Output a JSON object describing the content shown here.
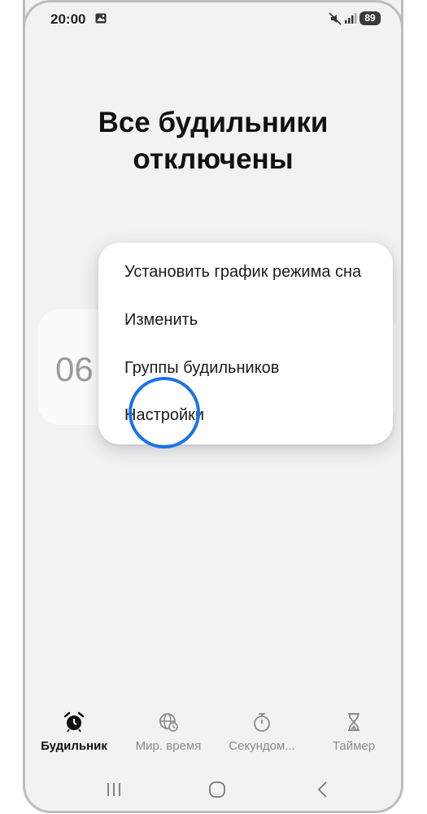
{
  "status_bar": {
    "time": "20:00",
    "battery": "89",
    "icons": [
      "gallery-icon",
      "mute-icon",
      "signal-icon",
      "battery-icon"
    ]
  },
  "main": {
    "headline_line1": "Все будильники",
    "headline_line2": "отключены",
    "alarm_time_partial": "06"
  },
  "menu": {
    "items": [
      {
        "label": "Установить график режима сна"
      },
      {
        "label": "Изменить"
      },
      {
        "label": "Группы будильников"
      },
      {
        "label": "Настройки"
      }
    ]
  },
  "bottom_nav": {
    "tabs": [
      {
        "label": "Будильник",
        "icon": "alarm-clock-icon",
        "active": true
      },
      {
        "label": "Мир. время",
        "icon": "globe-clock-icon",
        "active": false
      },
      {
        "label": "Секундом...",
        "icon": "stopwatch-icon",
        "active": false
      },
      {
        "label": "Таймер",
        "icon": "hourglass-icon",
        "active": false
      }
    ]
  },
  "system_nav": {
    "buttons": [
      "recents-icon",
      "home-icon",
      "back-icon"
    ]
  },
  "colors": {
    "highlight": "#1a73e8",
    "background": "#f2f2f4"
  }
}
